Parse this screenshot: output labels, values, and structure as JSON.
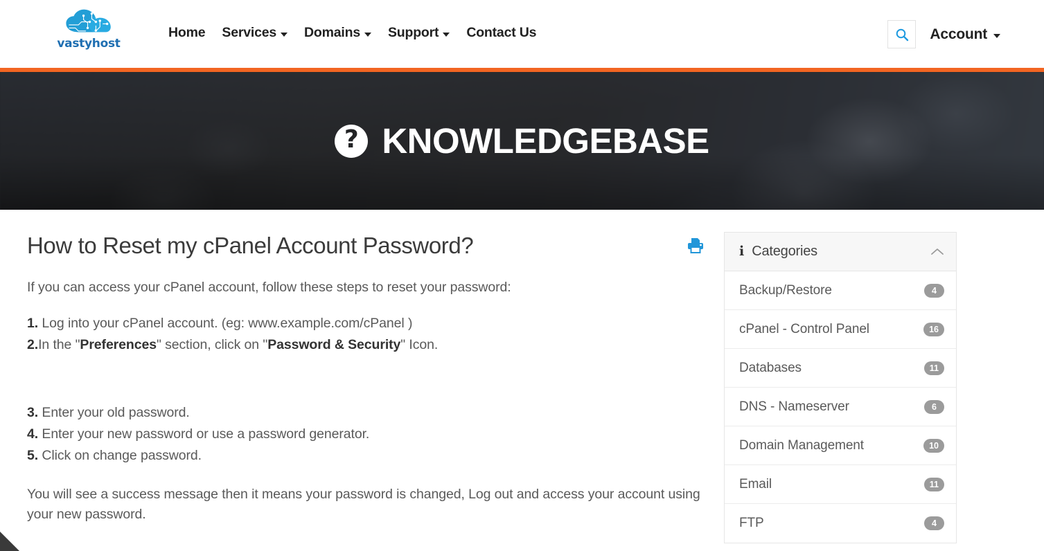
{
  "header": {
    "logo": {
      "text": "vastyhost",
      "icon": "cloud-circuit-icon",
      "color": "#1f6fb2"
    },
    "nav": [
      {
        "label": "Home",
        "has_dropdown": false
      },
      {
        "label": "Services",
        "has_dropdown": true
      },
      {
        "label": "Domains",
        "has_dropdown": true
      },
      {
        "label": "Support",
        "has_dropdown": true
      },
      {
        "label": "Contact Us",
        "has_dropdown": false
      }
    ],
    "search_icon": "search-icon",
    "account_label": "Account",
    "accent_color": "#f26522"
  },
  "hero": {
    "icon": "question-mark-circle-icon",
    "icon_glyph": "?",
    "title": "KNOWLEDGEBASE"
  },
  "article": {
    "title": "How to Reset my cPanel Account Password?",
    "intro": "If you can access your cPanel account, follow these steps to reset your password:",
    "print_icon": "printer-icon",
    "print_icon_color": "#2196d9",
    "steps": [
      {
        "num": "1.",
        "parts": [
          {
            "t": "Log into your cPanel account. (eg: www.example.com/cPanel )",
            "b": false
          }
        ]
      },
      {
        "num": "2.",
        "parts": [
          {
            "t": "In the \"",
            "b": false
          },
          {
            "t": "Preferences",
            "b": true
          },
          {
            "t": "\" section, click on \"",
            "b": false
          },
          {
            "t": "Password & Security",
            "b": true
          },
          {
            "t": "\" Icon.",
            "b": false
          }
        ]
      }
    ],
    "steps_after": [
      {
        "num": "3.",
        "parts": [
          {
            "t": "Enter your old password.",
            "b": false
          }
        ]
      },
      {
        "num": "4.",
        "parts": [
          {
            "t": "Enter your new password or use a password generator.",
            "b": false
          }
        ]
      },
      {
        "num": "5.",
        "parts": [
          {
            "t": "Click on change password.",
            "b": false
          }
        ]
      }
    ],
    "closing": "You will see a success message then it means your password is changed, Log out and access your account using your new password."
  },
  "sidebar": {
    "panel_title": "Categories",
    "info_icon": "info-icon",
    "collapse_icon": "chevron-up-icon",
    "categories": [
      {
        "label": "Backup/Restore",
        "count": "4"
      },
      {
        "label": "cPanel - Control Panel",
        "count": "16"
      },
      {
        "label": "Databases",
        "count": "11"
      },
      {
        "label": "DNS - Nameserver",
        "count": "6"
      },
      {
        "label": "Domain Management",
        "count": "10"
      },
      {
        "label": "Email",
        "count": "11"
      },
      {
        "label": "FTP",
        "count": "4"
      }
    ]
  }
}
